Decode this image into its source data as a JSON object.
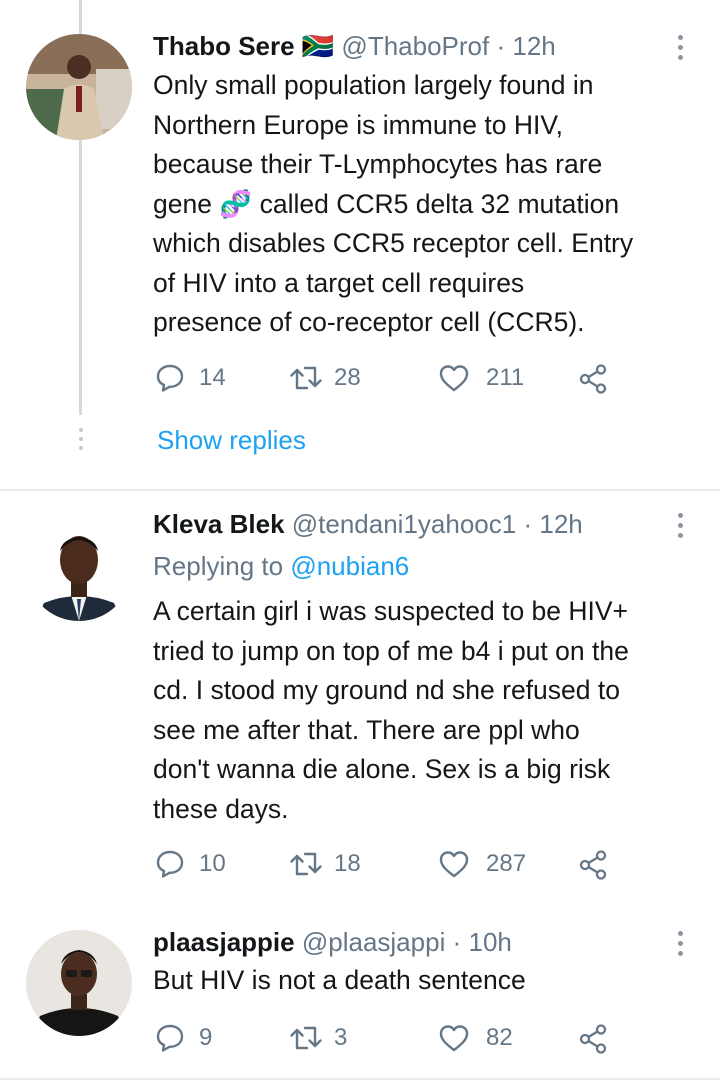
{
  "tweets": [
    {
      "name": "Thabo Sere 🇿🇦",
      "handle": "@ThaboProf",
      "time": "12h",
      "text_lines": [
        "Only small population largely found in",
        "Northern Europe is immune to HIV,",
        "because their T-Lymphocytes has rare",
        "gene 🧬 called CCR5 delta 32 mutation",
        "which disables CCR5 receptor cell. Entry",
        "of HIV into a target cell requires",
        "presence of co-receptor cell (CCR5)."
      ],
      "replies": "14",
      "retweets": "28",
      "likes": "211",
      "show_replies": "Show replies"
    },
    {
      "name": "Kleva Blek",
      "handle": "@tendani1yahooc1",
      "time": "12h",
      "replying_label": "Replying to",
      "replying_to": "@nubian6",
      "text_lines": [
        "A certain girl i was suspected to be HIV+",
        "tried to jump on top of me b4 i put on the",
        "cd. I stood my ground nd she refused to",
        "see me after that. There are ppl who",
        "don't wanna die alone. Sex is a big risk",
        "these days."
      ],
      "replies": "10",
      "retweets": "18",
      "likes": "287"
    },
    {
      "name": "plaasjappie",
      "handle": "@plaasjappi",
      "time": "10h",
      "text_lines": [
        "But HIV is not a death sentence"
      ],
      "replies": "9",
      "retweets": "3",
      "likes": "82"
    }
  ],
  "colors": {
    "link": "#1da1f2",
    "secondary_text": "#657786",
    "icon": "#657786",
    "divider": "#e6ecf0"
  },
  "icons": {
    "reply": "reply-icon",
    "retweet": "retweet-icon",
    "like": "heart-icon",
    "share": "share-icon",
    "more": "more-vertical-icon"
  }
}
